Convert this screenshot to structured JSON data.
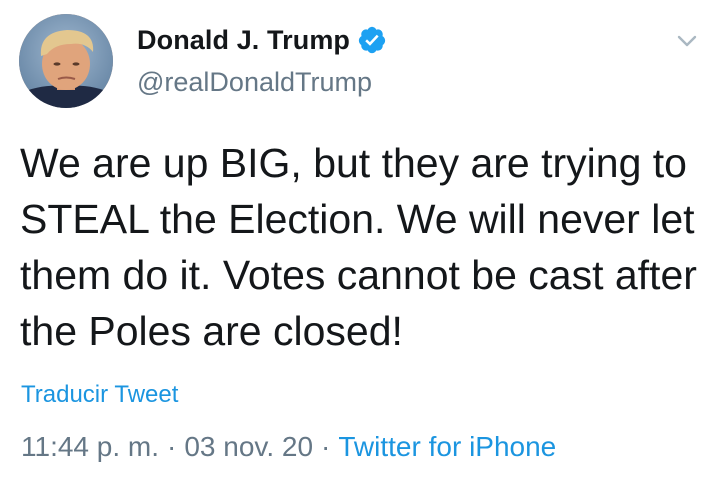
{
  "author": {
    "display_name": "Donald J. Trump",
    "handle": "@realDonaldTrump",
    "verified": true
  },
  "tweet": {
    "text": "We are up BIG, but they are trying to STEAL the Election. We will never let them do it. Votes cannot be cast after the Poles are closed!",
    "translate_label": "Traducir Tweet",
    "time": "11:44 p. m.",
    "date": "03 nov. 20",
    "source": "Twitter for iPhone",
    "separator": "·"
  },
  "icons": {
    "verified": "verified-badge-icon",
    "menu": "chevron-down-icon"
  },
  "colors": {
    "text_primary": "#14171a",
    "text_secondary": "#657786",
    "link": "#1b95e0",
    "verified_badge": "#1da1f2",
    "caret": "#aab8c2"
  }
}
